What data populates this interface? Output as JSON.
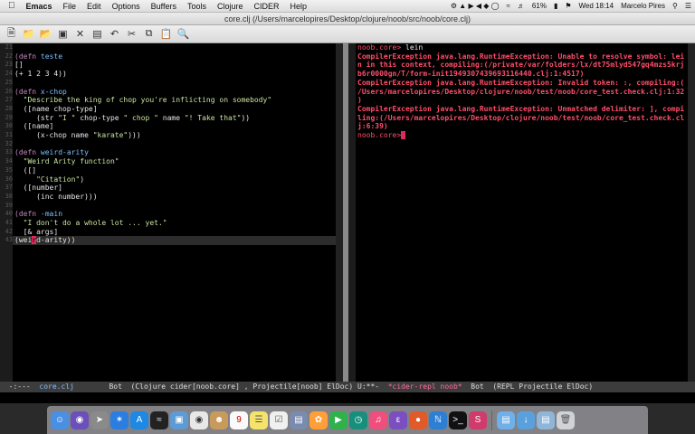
{
  "menubar": {
    "app": "Emacs",
    "items": [
      "File",
      "Edit",
      "Options",
      "Buffers",
      "Tools",
      "Clojure",
      "CIDER",
      "Help"
    ],
    "battery": "61%",
    "clock": "Wed 18:14",
    "user": "Marcelo Pires"
  },
  "window": {
    "title": "core.clj (/Users/marcelopires/Desktop/clojure/noob/src/noob/core.clj)"
  },
  "left_pane": {
    "line_numbers": [
      "21",
      "22",
      "23",
      "24",
      "25",
      "26",
      "27",
      "28",
      "29",
      "30",
      "31",
      "32",
      "33",
      "34",
      "35",
      "36",
      "37",
      "38",
      "39",
      "40",
      "41",
      "42",
      "43"
    ]
  },
  "right_pane": {
    "prompt": "noob.core>",
    "command": "lein",
    "errors": [
      "CompilerException java.lang.RuntimeException: Unable to resolve symbol: lei",
      "n in this context, compiling:(/private/var/folders/lx/dt75mlyd547gq4mzs5krj",
      "b6r0000gn/T/form-init1949307439693116440.clj:1:4517)",
      "CompilerException java.lang.RuntimeException: Invalid token: :, compiling:(",
      "/Users/marcelopires/Desktop/clojure/noob/test/noob/core_test.check.clj:1:32",
      ")",
      "CompilerException java.lang.RuntimeException: Unmatched delimiter: ], compi",
      "ling:(/Users/marcelopires/Desktop/clojure/noob/test/noob/core_test.check.cl",
      "j:6:39)"
    ],
    "final_prompt": "noob.core>"
  },
  "modeline": {
    "left_status": "-:---",
    "left_buffer": "core.clj",
    "left_pos": "Bot",
    "left_modes": "(Clojure cider[noob.core] , Projectile[noob] ElDoc)",
    "right_status": "U:**-",
    "right_buffer": "*cider-repl noob*",
    "right_pos": "Bot",
    "right_modes": "(REPL Projectile ElDoc)"
  },
  "dock": {
    "apps": [
      "finder-icon",
      "siri-icon",
      "launchpad-icon",
      "safari-icon",
      "app-store-icon",
      "terminal-wifi-icon",
      "preview-icon",
      "chrome-icon",
      "contacts-icon",
      "calendar-icon",
      "notes-icon",
      "reminders-icon",
      "photos-icon",
      "photos-app-icon",
      "facetime-icon",
      "vivaldi-icon",
      "itunes-icon",
      "emacs-icon",
      "app-icon",
      "vscode-icon",
      "terminal-icon",
      "slack-icon",
      "folder-icon",
      "downloads-icon",
      "documents-icon",
      "trash-icon"
    ]
  }
}
